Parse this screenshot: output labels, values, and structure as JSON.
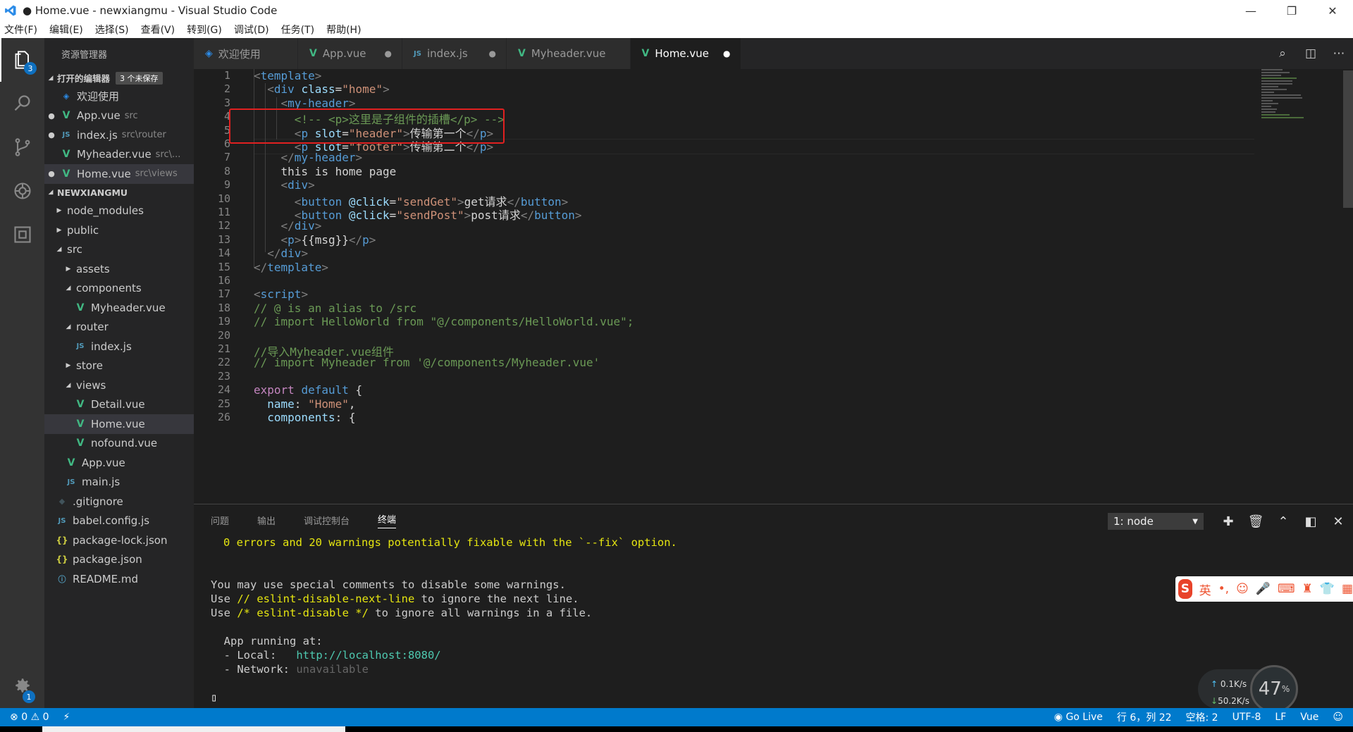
{
  "window": {
    "title": "● Home.vue - newxiangmu - Visual Studio Code"
  },
  "menu": [
    "文件(F)",
    "编辑(E)",
    "选择(S)",
    "查看(V)",
    "转到(G)",
    "调试(D)",
    "任务(T)",
    "帮助(H)"
  ],
  "activity": {
    "explorer_badge": "3",
    "settings_badge": "1"
  },
  "sidebar": {
    "header": "资源管理器",
    "open_editors": {
      "label": "打开的编辑器",
      "unsaved": "3 个未保存"
    },
    "open_files": [
      {
        "name": "欢迎使用",
        "desc": "",
        "icon": "vscode-icon",
        "dirty": false
      },
      {
        "name": "App.vue",
        "desc": "src",
        "icon": "vue-icon",
        "dirty": true
      },
      {
        "name": "index.js",
        "desc": "src\\router",
        "icon": "js-icon",
        "dirty": true
      },
      {
        "name": "Myheader.vue",
        "desc": "src\\...",
        "icon": "vue-icon",
        "dirty": false
      },
      {
        "name": "Home.vue",
        "desc": "src\\views",
        "icon": "vue-icon",
        "dirty": true
      }
    ],
    "project": "NEWXIANGMU",
    "tree": [
      {
        "name": "node_modules",
        "depth": 0,
        "type": "folder-closed"
      },
      {
        "name": "public",
        "depth": 0,
        "type": "folder-closed"
      },
      {
        "name": "src",
        "depth": 0,
        "type": "folder-open"
      },
      {
        "name": "assets",
        "depth": 1,
        "type": "folder-closed"
      },
      {
        "name": "components",
        "depth": 1,
        "type": "folder-open"
      },
      {
        "name": "Myheader.vue",
        "depth": 2,
        "type": "vue"
      },
      {
        "name": "router",
        "depth": 1,
        "type": "folder-open"
      },
      {
        "name": "index.js",
        "depth": 2,
        "type": "js"
      },
      {
        "name": "store",
        "depth": 1,
        "type": "folder-closed"
      },
      {
        "name": "views",
        "depth": 1,
        "type": "folder-open"
      },
      {
        "name": "Detail.vue",
        "depth": 2,
        "type": "vue"
      },
      {
        "name": "Home.vue",
        "depth": 2,
        "type": "vue",
        "selected": true
      },
      {
        "name": "nofound.vue",
        "depth": 2,
        "type": "vue"
      },
      {
        "name": "App.vue",
        "depth": 1,
        "type": "vue"
      },
      {
        "name": "main.js",
        "depth": 1,
        "type": "js"
      },
      {
        "name": ".gitignore",
        "depth": 0,
        "type": "git"
      },
      {
        "name": "babel.config.js",
        "depth": 0,
        "type": "js"
      },
      {
        "name": "package-lock.json",
        "depth": 0,
        "type": "json"
      },
      {
        "name": "package.json",
        "depth": 0,
        "type": "json"
      },
      {
        "name": "README.md",
        "depth": 0,
        "type": "info"
      }
    ]
  },
  "tabs": [
    {
      "label": "欢迎使用",
      "icon": "vscode-icon",
      "dirty": false
    },
    {
      "label": "App.vue",
      "icon": "vue-icon",
      "dirty": true
    },
    {
      "label": "index.js",
      "icon": "js-icon",
      "dirty": true
    },
    {
      "label": "Myheader.vue",
      "icon": "vue-icon",
      "dirty": false
    },
    {
      "label": "Home.vue",
      "icon": "vue-icon",
      "dirty": true,
      "active": true
    }
  ],
  "editor": {
    "lines": [
      [
        [
          "t",
          "<"
        ],
        [
          "tg",
          "template"
        ],
        [
          "t",
          ">"
        ]
      ],
      [
        [
          "pl",
          "  "
        ],
        [
          "t",
          "<"
        ],
        [
          "tg",
          "div"
        ],
        [
          "pl",
          " "
        ],
        [
          "at",
          "class"
        ],
        [
          "pl",
          "="
        ],
        [
          "st",
          "\"home\""
        ],
        [
          "t",
          ">"
        ]
      ],
      [
        [
          "pl",
          "    "
        ],
        [
          "t",
          "<"
        ],
        [
          "tg",
          "my-header"
        ],
        [
          "t",
          ">"
        ]
      ],
      [
        [
          "pl",
          "      "
        ],
        [
          "cm",
          "<!-- <p>这里是子组件的插槽</p> -->"
        ]
      ],
      [
        [
          "pl",
          "      "
        ],
        [
          "t",
          "<"
        ],
        [
          "tg",
          "p"
        ],
        [
          "pl",
          " "
        ],
        [
          "at",
          "slot"
        ],
        [
          "pl",
          "="
        ],
        [
          "st",
          "\"header\""
        ],
        [
          "t",
          ">"
        ],
        [
          "pl",
          "传输第一个"
        ],
        [
          "t",
          "</"
        ],
        [
          "tg",
          "p"
        ],
        [
          "t",
          ">"
        ]
      ],
      [
        [
          "pl",
          "      "
        ],
        [
          "t",
          "<"
        ],
        [
          "tg",
          "p"
        ],
        [
          "pl",
          " "
        ],
        [
          "at",
          "slot"
        ],
        [
          "pl",
          "="
        ],
        [
          "st",
          "\"footer\""
        ],
        [
          "t",
          ">"
        ],
        [
          "pl",
          "传输第二个"
        ],
        [
          "t",
          "</"
        ],
        [
          "tg",
          "p"
        ],
        [
          "t",
          ">"
        ]
      ],
      [
        [
          "pl",
          "    "
        ],
        [
          "t",
          "</"
        ],
        [
          "tg",
          "my-header"
        ],
        [
          "t",
          ">"
        ]
      ],
      [
        [
          "pl",
          "    this is home page"
        ]
      ],
      [
        [
          "pl",
          "    "
        ],
        [
          "t",
          "<"
        ],
        [
          "tg",
          "div"
        ],
        [
          "t",
          ">"
        ]
      ],
      [
        [
          "pl",
          "      "
        ],
        [
          "t",
          "<"
        ],
        [
          "tg",
          "button"
        ],
        [
          "pl",
          " "
        ],
        [
          "at",
          "@click"
        ],
        [
          "pl",
          "="
        ],
        [
          "st",
          "\"sendGet\""
        ],
        [
          "t",
          ">"
        ],
        [
          "pl",
          "get请求"
        ],
        [
          "t",
          "</"
        ],
        [
          "tg",
          "button"
        ],
        [
          "t",
          ">"
        ]
      ],
      [
        [
          "pl",
          "      "
        ],
        [
          "t",
          "<"
        ],
        [
          "tg",
          "button"
        ],
        [
          "pl",
          " "
        ],
        [
          "at",
          "@click"
        ],
        [
          "pl",
          "="
        ],
        [
          "st",
          "\"sendPost\""
        ],
        [
          "t",
          ">"
        ],
        [
          "pl",
          "post请求"
        ],
        [
          "t",
          "</"
        ],
        [
          "tg",
          "button"
        ],
        [
          "t",
          ">"
        ]
      ],
      [
        [
          "pl",
          "    "
        ],
        [
          "t",
          "</"
        ],
        [
          "tg",
          "div"
        ],
        [
          "t",
          ">"
        ]
      ],
      [
        [
          "pl",
          "    "
        ],
        [
          "t",
          "<"
        ],
        [
          "tg",
          "p"
        ],
        [
          "t",
          ">"
        ],
        [
          "pl",
          "{{msg}}"
        ],
        [
          "t",
          "</"
        ],
        [
          "tg",
          "p"
        ],
        [
          "t",
          ">"
        ]
      ],
      [
        [
          "pl",
          "  "
        ],
        [
          "t",
          "</"
        ],
        [
          "tg",
          "div"
        ],
        [
          "t",
          ">"
        ]
      ],
      [
        [
          "t",
          "</"
        ],
        [
          "tg",
          "template"
        ],
        [
          "t",
          ">"
        ]
      ],
      [],
      [
        [
          "t",
          "<"
        ],
        [
          "tg",
          "script"
        ],
        [
          "t",
          ">"
        ]
      ],
      [
        [
          "cm",
          "// @ is an alias to /src"
        ]
      ],
      [
        [
          "cm",
          "// import HelloWorld from \"@/components/HelloWorld.vue\";"
        ]
      ],
      [],
      [
        [
          "cm",
          "//导入Myheader.vue组件"
        ]
      ],
      [
        [
          "cm",
          "// import Myheader from '@/components/Myheader.vue'"
        ]
      ],
      [],
      [
        [
          "ky",
          "export"
        ],
        [
          "pl",
          " "
        ],
        [
          "kw",
          "default"
        ],
        [
          "pl",
          " {"
        ]
      ],
      [
        [
          "pl",
          "  "
        ],
        [
          "at",
          "name"
        ],
        [
          "pl",
          ": "
        ],
        [
          "st",
          "\"Home\""
        ],
        [
          "pl",
          ","
        ]
      ],
      [
        [
          "pl",
          "  "
        ],
        [
          "at",
          "components"
        ],
        [
          "pl",
          ": {"
        ]
      ]
    ]
  },
  "panel": {
    "tabs": [
      "问题",
      "输出",
      "调试控制台",
      "终端"
    ],
    "terminal_select": "1: node",
    "terminal": {
      "fix_line": "0 errors and 20 warnings potentially fixable with the `--fix` option.",
      "l1": "You may use special comments to disable some warnings.",
      "l2a": "Use ",
      "l2b": "// eslint-disable-next-line",
      "l2c": " to ignore the next line.",
      "l3a": "Use ",
      "l3b": "/* eslint-disable */",
      "l3c": " to ignore all warnings in a file.",
      "l4": "  App running at:",
      "l5a": "  - Local:   ",
      "l5b": "http://localhost:8080/",
      "l6a": "  - Network: ",
      "l6b": "unavailable"
    }
  },
  "ime": {
    "mode": "英"
  },
  "net": {
    "up": "0.1K/s",
    "down": "50.2K/s",
    "percent": "47",
    "unit": "%"
  },
  "status": {
    "errors": "0",
    "warnings": "0",
    "golive": "Go Live",
    "position": "行 6，列 22",
    "spaces": "空格: 2",
    "encoding": "UTF-8",
    "eol": "LF",
    "language": "Vue"
  }
}
